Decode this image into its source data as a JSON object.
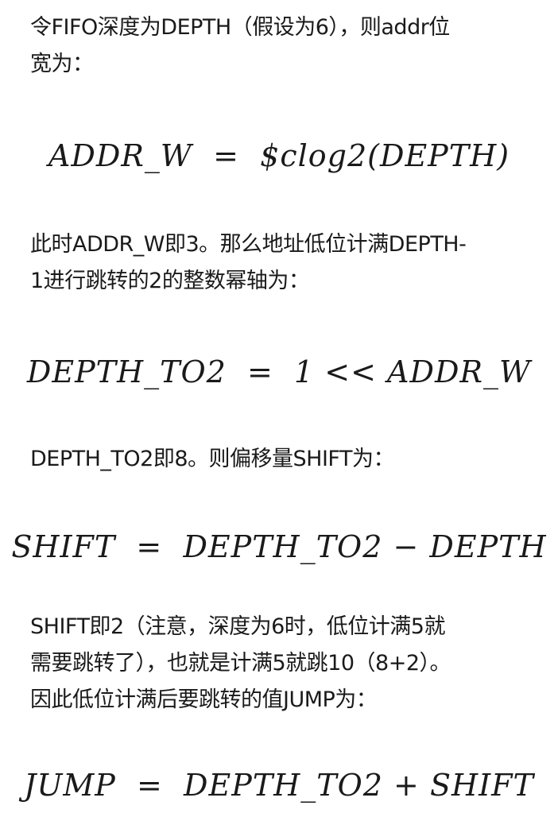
{
  "paragraphs": [
    [
      "令FIFO深度为DEPTH（假设为6），则addr位",
      "宽为："
    ],
    [
      "此时ADDR_W即3。那么地址低位计满DEPTH-",
      "1进行跳转的2的整数幂轴为："
    ],
    [
      "DEPTH_TO2即8。则偏移量SHIFT为："
    ],
    [
      "SHIFT即2（注意，深度为6时，低位计满5就",
      "需要跳转了），也就是计满5就跳10（8+2）。",
      "因此低位计满后要跳转的值JUMP为："
    ]
  ],
  "formulas": [
    {
      "lhs": "ADDR_W",
      "op": "=",
      "rhs": "$clog2(DEPTH)"
    },
    {
      "lhs": "DEPTH_TO2",
      "op": "=",
      "rhs": "1 << ADDR_W"
    },
    {
      "lhs": "SHIFT",
      "op": "=",
      "rhs": "DEPTH_TO2 − DEPTH"
    },
    {
      "lhs": "JUMP",
      "op": "=",
      "rhs": "DEPTH_TO2 + SHIFT"
    }
  ]
}
